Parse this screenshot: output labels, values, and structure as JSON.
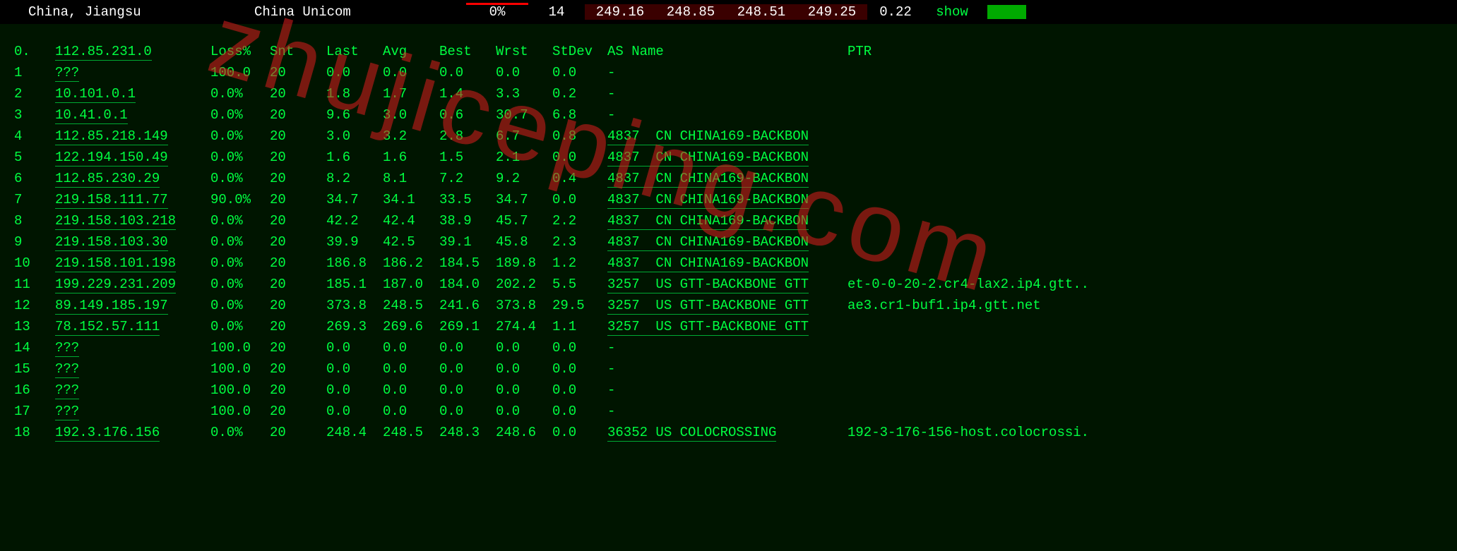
{
  "topbar": {
    "location": "China, Jiangsu",
    "isp": "China Unicom",
    "loss_pct": "0%",
    "count": "14",
    "ping1": "249.16",
    "ping2": "248.85",
    "ping3": "248.51",
    "ping4": "249.25",
    "stdev": "0.22",
    "show_label": "show"
  },
  "headers": {
    "hop": "0.",
    "ip": "112.85.231.0",
    "loss": "Loss%",
    "snt": "Snt",
    "last": "Last",
    "avg": "Avg",
    "best": "Best",
    "wrst": "Wrst",
    "stdev": "StDev",
    "asname": "AS Name",
    "ptr": "PTR"
  },
  "rows": [
    {
      "hop": "1",
      "ip": "???",
      "loss": "100.0",
      "snt": "20",
      "last": "0.0",
      "avg": "0.0",
      "best": "0.0",
      "wrst": "0.0",
      "stdev": "0.0",
      "as": "-",
      "ptr": ""
    },
    {
      "hop": "2",
      "ip": "10.101.0.1",
      "loss": "0.0%",
      "snt": "20",
      "last": "1.8",
      "avg": "1.7",
      "best": "1.4",
      "wrst": "3.3",
      "stdev": "0.2",
      "as": "-",
      "ptr": ""
    },
    {
      "hop": "3",
      "ip": "10.41.0.1",
      "loss": "0.0%",
      "snt": "20",
      "last": "9.6",
      "avg": "3.0",
      "best": "0.6",
      "wrst": "30.7",
      "stdev": "6.8",
      "as": "-",
      "ptr": ""
    },
    {
      "hop": "4",
      "ip": "112.85.218.149",
      "loss": "0.0%",
      "snt": "20",
      "last": "3.0",
      "avg": "3.2",
      "best": "2.8",
      "wrst": "6.7",
      "stdev": "0.8",
      "as": "4837  CN CHINA169-BACKBON",
      "ptr": ""
    },
    {
      "hop": "5",
      "ip": "122.194.150.49",
      "loss": "0.0%",
      "snt": "20",
      "last": "1.6",
      "avg": "1.6",
      "best": "1.5",
      "wrst": "2.1",
      "stdev": "0.0",
      "as": "4837  CN CHINA169-BACKBON",
      "ptr": ""
    },
    {
      "hop": "6",
      "ip": "112.85.230.29",
      "loss": "0.0%",
      "snt": "20",
      "last": "8.2",
      "avg": "8.1",
      "best": "7.2",
      "wrst": "9.2",
      "stdev": "0.4",
      "as": "4837  CN CHINA169-BACKBON",
      "ptr": ""
    },
    {
      "hop": "7",
      "ip": "219.158.111.77",
      "loss": "90.0%",
      "snt": "20",
      "last": "34.7",
      "avg": "34.1",
      "best": "33.5",
      "wrst": "34.7",
      "stdev": "0.0",
      "as": "4837  CN CHINA169-BACKBON",
      "ptr": ""
    },
    {
      "hop": "8",
      "ip": "219.158.103.218",
      "loss": "0.0%",
      "snt": "20",
      "last": "42.2",
      "avg": "42.4",
      "best": "38.9",
      "wrst": "45.7",
      "stdev": "2.2",
      "as": "4837  CN CHINA169-BACKBON",
      "ptr": ""
    },
    {
      "hop": "9",
      "ip": "219.158.103.30",
      "loss": "0.0%",
      "snt": "20",
      "last": "39.9",
      "avg": "42.5",
      "best": "39.1",
      "wrst": "45.8",
      "stdev": "2.3",
      "as": "4837  CN CHINA169-BACKBON",
      "ptr": ""
    },
    {
      "hop": "10",
      "ip": "219.158.101.198",
      "loss": "0.0%",
      "snt": "20",
      "last": "186.8",
      "avg": "186.2",
      "best": "184.5",
      "wrst": "189.8",
      "stdev": "1.2",
      "as": "4837  CN CHINA169-BACKBON",
      "ptr": ""
    },
    {
      "hop": "11",
      "ip": "199.229.231.209",
      "loss": "0.0%",
      "snt": "20",
      "last": "185.1",
      "avg": "187.0",
      "best": "184.0",
      "wrst": "202.2",
      "stdev": "5.5",
      "as": "3257  US GTT-BACKBONE GTT",
      "ptr": "et-0-0-20-2.cr4-lax2.ip4.gtt.."
    },
    {
      "hop": "12",
      "ip": "89.149.185.197",
      "loss": "0.0%",
      "snt": "20",
      "last": "373.8",
      "avg": "248.5",
      "best": "241.6",
      "wrst": "373.8",
      "stdev": "29.5",
      "as": "3257  US GTT-BACKBONE GTT",
      "ptr": "ae3.cr1-buf1.ip4.gtt.net"
    },
    {
      "hop": "13",
      "ip": "78.152.57.111",
      "loss": "0.0%",
      "snt": "20",
      "last": "269.3",
      "avg": "269.6",
      "best": "269.1",
      "wrst": "274.4",
      "stdev": "1.1",
      "as": "3257  US GTT-BACKBONE GTT",
      "ptr": ""
    },
    {
      "hop": "14",
      "ip": "???",
      "loss": "100.0",
      "snt": "20",
      "last": "0.0",
      "avg": "0.0",
      "best": "0.0",
      "wrst": "0.0",
      "stdev": "0.0",
      "as": "-",
      "ptr": ""
    },
    {
      "hop": "15",
      "ip": "???",
      "loss": "100.0",
      "snt": "20",
      "last": "0.0",
      "avg": "0.0",
      "best": "0.0",
      "wrst": "0.0",
      "stdev": "0.0",
      "as": "-",
      "ptr": ""
    },
    {
      "hop": "16",
      "ip": "???",
      "loss": "100.0",
      "snt": "20",
      "last": "0.0",
      "avg": "0.0",
      "best": "0.0",
      "wrst": "0.0",
      "stdev": "0.0",
      "as": "-",
      "ptr": ""
    },
    {
      "hop": "17",
      "ip": "???",
      "loss": "100.0",
      "snt": "20",
      "last": "0.0",
      "avg": "0.0",
      "best": "0.0",
      "wrst": "0.0",
      "stdev": "0.0",
      "as": "-",
      "ptr": ""
    },
    {
      "hop": "18",
      "ip": "192.3.176.156",
      "loss": "0.0%",
      "snt": "20",
      "last": "248.4",
      "avg": "248.5",
      "best": "248.3",
      "wrst": "248.6",
      "stdev": "0.0",
      "as": "36352 US COLOCROSSING",
      "ptr": "192-3-176-156-host.colocrossi."
    }
  ],
  "watermark": "zhujiceping.com"
}
